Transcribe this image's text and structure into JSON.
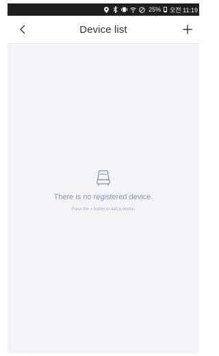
{
  "status_bar": {
    "battery": "25%",
    "time": "오전 11:19"
  },
  "header": {
    "title": "Device list"
  },
  "empty_state": {
    "headline": "There is no registered device.",
    "hint": "Press the + button to add a device."
  },
  "colors": {
    "background": "#f2f4f8",
    "header": "#ffffff",
    "status_bar": "#1f1f1f",
    "text_primary": "#333333",
    "text_muted": "#8c93a3"
  }
}
